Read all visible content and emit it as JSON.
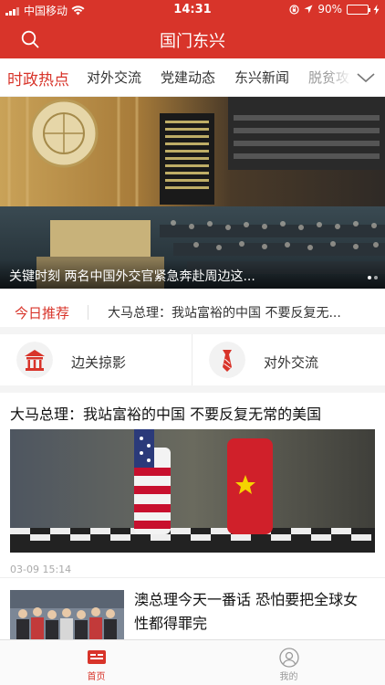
{
  "status_bar": {
    "carrier": "中国移动",
    "time": "14:31",
    "battery": "90%",
    "battery_level": 0.9
  },
  "nav": {
    "title": "国门东兴"
  },
  "tabs": [
    {
      "label": "时政热点"
    },
    {
      "label": "对外交流"
    },
    {
      "label": "党建动态"
    },
    {
      "label": "东兴新闻"
    },
    {
      "label": "脱贫攻"
    }
  ],
  "banner": {
    "caption": "关键时刻 两名中国外交官紧急奔赴周边这..."
  },
  "today": {
    "label": "今日推荐",
    "text": "大马总理：我站富裕的中国 不要反复无..."
  },
  "quick_links": [
    {
      "label": "边关掠影",
      "icon": "gate-icon"
    },
    {
      "label": "对外交流",
      "icon": "tie-icon"
    }
  ],
  "articles": [
    {
      "title": "大马总理：我站富裕的中国 不要反复无常的美国",
      "date": "03-09 15:14"
    },
    {
      "title": "澳总理今天一番话 恐怕要把全球女性都得罪完"
    }
  ],
  "tabbar": [
    {
      "label": "首页"
    },
    {
      "label": "我的"
    }
  ],
  "colors": {
    "brand_red": "#d8342a",
    "battery_green": "#4cd964"
  }
}
